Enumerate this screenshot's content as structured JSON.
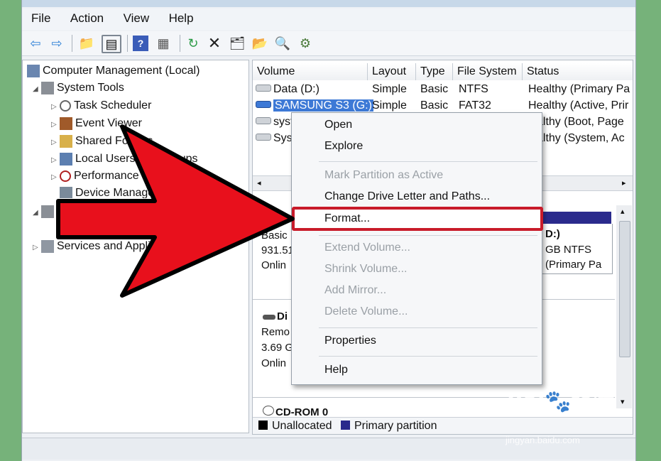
{
  "menu": [
    "File",
    "Action",
    "View",
    "Help"
  ],
  "tree": {
    "root": "Computer Management (Local)",
    "system_tools": "System Tools",
    "task_scheduler": "Task Scheduler",
    "event_viewer": "Event Viewer",
    "shared_folders": "Shared Folders",
    "local_users": "Local Users and Groups",
    "performance": "Performance",
    "device_manager": "Device Manager",
    "services": "Services and Applications"
  },
  "volumes": {
    "headers": [
      "Volume",
      "Layout",
      "Type",
      "File System",
      "Status"
    ],
    "rows": [
      {
        "volume": "Data (D:)",
        "layout": "Simple",
        "type": "Basic",
        "fs": "NTFS",
        "status": "Healthy (Primary Pa"
      },
      {
        "volume": "SAMSUNG S3 (G:)",
        "layout": "Simple",
        "type": "Basic",
        "fs": "FAT32",
        "status": "Healthy (Active, Prir"
      },
      {
        "volume": "syst",
        "layout": "",
        "type": "",
        "fs": "",
        "status": "althy (Boot, Page"
      },
      {
        "volume": "Sys",
        "layout": "",
        "type": "",
        "fs": "",
        "status": "althy (System, Ac"
      }
    ]
  },
  "disks": {
    "disk0_basic": "Basic",
    "disk0_size": "931.51",
    "disk0_state": "Onlin",
    "disk0_part_name": "D:)",
    "disk0_part_fs": "GB NTFS",
    "disk0_part_status": "(Primary Pa",
    "disk1_name": "Di",
    "disk1_type": "Remo",
    "disk1_size": "3.69 G",
    "disk1_state": "Onlin",
    "cdrom": "CD-ROM 0"
  },
  "legend": {
    "unallocated": "Unallocated",
    "primary": "Primary partition"
  },
  "context_menu": {
    "open": "Open",
    "explore": "Explore",
    "mark_active": "Mark Partition as Active",
    "change_letter": "Change Drive Letter and Paths...",
    "format": "Format...",
    "extend": "Extend Volume...",
    "shrink": "Shrink Volume...",
    "add_mirror": "Add Mirror...",
    "delete": "Delete Volume...",
    "properties": "Properties",
    "help": "Help"
  },
  "watermark": {
    "brand": "Bai",
    "brand2": "经验",
    "url": "jingyan.baidu.com"
  },
  "colors": {
    "highlight": "#c81b2a",
    "arrow": "#e8101c",
    "primary_partition": "#2a2a8c",
    "selection": "#3d79d6"
  }
}
